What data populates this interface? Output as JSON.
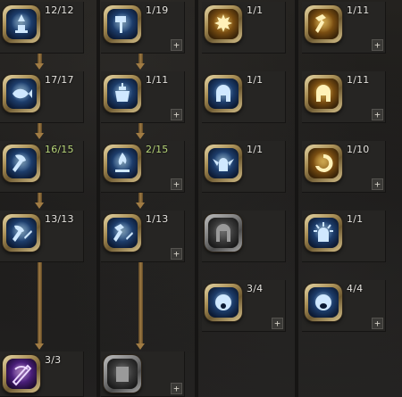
{
  "skills": [
    {
      "id": "r0c0",
      "count": "12/12",
      "theme": "blue",
      "glyph": "pedestal-icon",
      "plus": false
    },
    {
      "id": "r0c1",
      "count": "1/19",
      "theme": "blue",
      "glyph": "hammer-icon",
      "plus": true
    },
    {
      "id": "r0c2",
      "count": "1/1",
      "theme": "gold",
      "glyph": "burst-helm-icon",
      "plus": false
    },
    {
      "id": "r0c3",
      "count": "1/11",
      "theme": "gold",
      "glyph": "golden-hammer-icon",
      "plus": true
    },
    {
      "id": "r1c0",
      "count": "17/17",
      "theme": "blue",
      "glyph": "fish-icon",
      "plus": false
    },
    {
      "id": "r1c1",
      "count": "1/11",
      "theme": "blue",
      "glyph": "pot-icon",
      "plus": true
    },
    {
      "id": "r1c2",
      "count": "1/1",
      "theme": "blue",
      "glyph": "helm-icon",
      "plus": false
    },
    {
      "id": "r1c3",
      "count": "1/11",
      "theme": "gold",
      "glyph": "golden-helm-icon",
      "plus": true
    },
    {
      "id": "r2c0",
      "count": "16/15",
      "theme": "blue",
      "glyph": "axe-strike-icon",
      "plus": false,
      "over": true
    },
    {
      "id": "r2c1",
      "count": "2/15",
      "theme": "blue",
      "glyph": "flame-altar-icon",
      "plus": true,
      "over": true
    },
    {
      "id": "r2c2",
      "count": "1/1",
      "theme": "blue",
      "glyph": "winged-helm-icon",
      "plus": false
    },
    {
      "id": "r2c3",
      "count": "1/10",
      "theme": "gold",
      "glyph": "golden-swirl-icon",
      "plus": true
    },
    {
      "id": "r3c0",
      "count": "13/13",
      "theme": "blue",
      "glyph": "axe-slash-icon",
      "plus": false
    },
    {
      "id": "r3c1",
      "count": "1/13",
      "theme": "blue",
      "glyph": "hammer-slash-icon",
      "plus": true
    },
    {
      "id": "r3c2",
      "count": "",
      "theme": "locked",
      "glyph": "locked-helm-icon",
      "plus": false
    },
    {
      "id": "r3c3",
      "count": "1/1",
      "theme": "blue",
      "glyph": "radiant-helm-icon",
      "plus": false
    },
    {
      "id": "r4c2",
      "count": "3/4",
      "theme": "blue",
      "glyph": "shout-face-icon",
      "plus": true
    },
    {
      "id": "r4c3",
      "count": "4/4",
      "theme": "blue",
      "glyph": "roar-face-icon",
      "plus": true
    },
    {
      "id": "r5c0",
      "count": "3/3",
      "theme": "purple",
      "glyph": "purple-slash-icon",
      "plus": false
    },
    {
      "id": "r5c1",
      "count": "",
      "theme": "locked",
      "glyph": "locked-armor-icon",
      "plus": true
    }
  ],
  "plus_label": "+",
  "colors": {
    "blue": "#6fb4ff",
    "gold": "#ffce5a",
    "purple": "#b07cff",
    "locked": "#8a8a8a",
    "over": "#b9d77a"
  }
}
